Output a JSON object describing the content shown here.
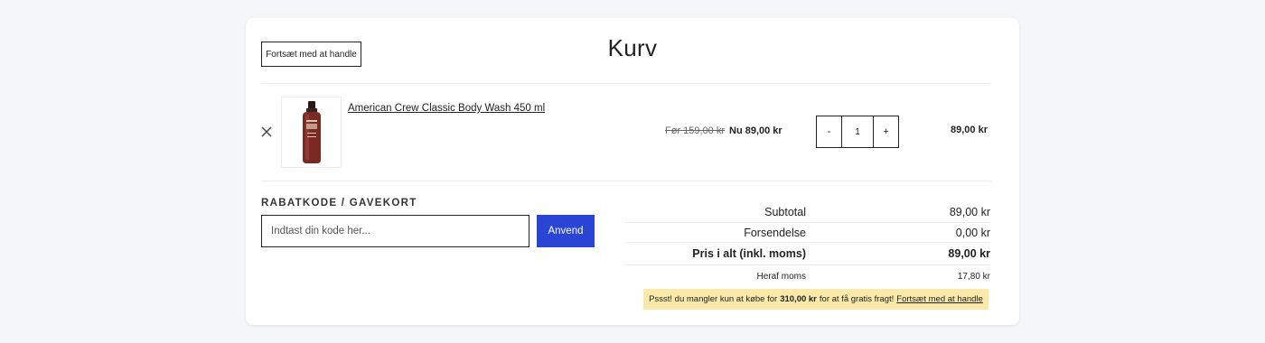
{
  "header": {
    "continue_label": "Fortsæt med at handle",
    "title": "Kurv"
  },
  "cart": {
    "items": [
      {
        "name": "American Crew Classic Body Wash 450 ml",
        "price_old": "Før 159,00 kr",
        "price_new": "Nu 89,00 kr",
        "quantity": "1",
        "qty_decrease": "-",
        "qty_increase": "+",
        "line_total": "89,00 kr",
        "image_icon": "product-bottle-icon"
      }
    ]
  },
  "coupon": {
    "heading": "RABATKODE / GAVEKORT",
    "placeholder": "Indtast din kode her...",
    "apply_label": "Anvend"
  },
  "totals": {
    "subtotal_label": "Subtotal",
    "subtotal_value": "89,00 kr",
    "shipping_label": "Forsendelse",
    "shipping_value": "0,00 kr",
    "total_label": "Pris i alt (inkl. moms)",
    "total_value": "89,00 kr",
    "vat_label": "Heraf moms",
    "vat_value": "17,80 kr"
  },
  "notice": {
    "text_before": "Pssst! du mangler kun at købe for",
    "amount": "310,00 kr",
    "text_after": "for at få gratis fragt!",
    "link": "Fortsæt med at handle"
  },
  "colors": {
    "accent": "#2a45d6",
    "notice_bg": "#fbe9a9",
    "page_bg": "#f5f6f8"
  }
}
